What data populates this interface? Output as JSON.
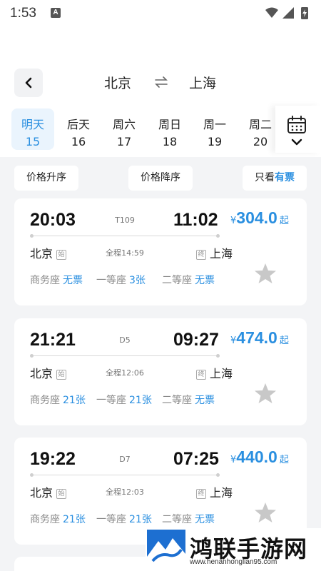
{
  "status_bar": {
    "time": "1:53",
    "notification_icon": "A"
  },
  "header": {
    "from_city": "北京",
    "to_city": "上海",
    "back_icon": "chevron-left-icon",
    "swap_icon": "swap-arrows-icon"
  },
  "dates": [
    {
      "label": "明天",
      "day": "15",
      "active": true
    },
    {
      "label": "后天",
      "day": "16"
    },
    {
      "label": "周六",
      "day": "17"
    },
    {
      "label": "周日",
      "day": "18"
    },
    {
      "label": "周一",
      "day": "19"
    },
    {
      "label": "周二",
      "day": "20"
    }
  ],
  "filters": {
    "price_asc": "价格升序",
    "price_desc": "价格降序",
    "only_show": "只看",
    "only_tickets": "有票"
  },
  "accent_color": "#2a8fe0",
  "trains": [
    {
      "departure_time": "20:03",
      "train_no": "T109",
      "arrival_time": "11:02",
      "from_station": "北京",
      "from_tag": "始",
      "duration": "全程14:59",
      "to_tag": "终",
      "to_station": "上海",
      "price_symbol": "¥",
      "price": "304.0",
      "price_suffix": "起",
      "seats": [
        {
          "name": "商务座",
          "count": "无票"
        },
        {
          "name": "一等座",
          "count": "3张"
        },
        {
          "name": "二等座",
          "count": "无票"
        }
      ]
    },
    {
      "departure_time": "21:21",
      "train_no": "D5",
      "arrival_time": "09:27",
      "from_station": "北京",
      "from_tag": "始",
      "duration": "全程12:06",
      "to_tag": "终",
      "to_station": "上海",
      "price_symbol": "¥",
      "price": "474.0",
      "price_suffix": "起",
      "seats": [
        {
          "name": "商务座",
          "count": "21张"
        },
        {
          "name": "一等座",
          "count": "21张"
        },
        {
          "name": "二等座",
          "count": "无票"
        }
      ]
    },
    {
      "departure_time": "19:22",
      "train_no": "D7",
      "arrival_time": "07:25",
      "from_station": "北京",
      "from_tag": "始",
      "duration": "全程12:03",
      "to_tag": "终",
      "to_station": "上海",
      "price_symbol": "¥",
      "price": "440.0",
      "price_suffix": "起",
      "seats": [
        {
          "name": "商务座",
          "count": "21张"
        },
        {
          "name": "一等座",
          "count": "21张"
        },
        {
          "name": "二等座",
          "count": "无票"
        }
      ]
    }
  ],
  "watermark": {
    "title": "鸿联手游网",
    "url": "www.henanhonglian95.com"
  }
}
